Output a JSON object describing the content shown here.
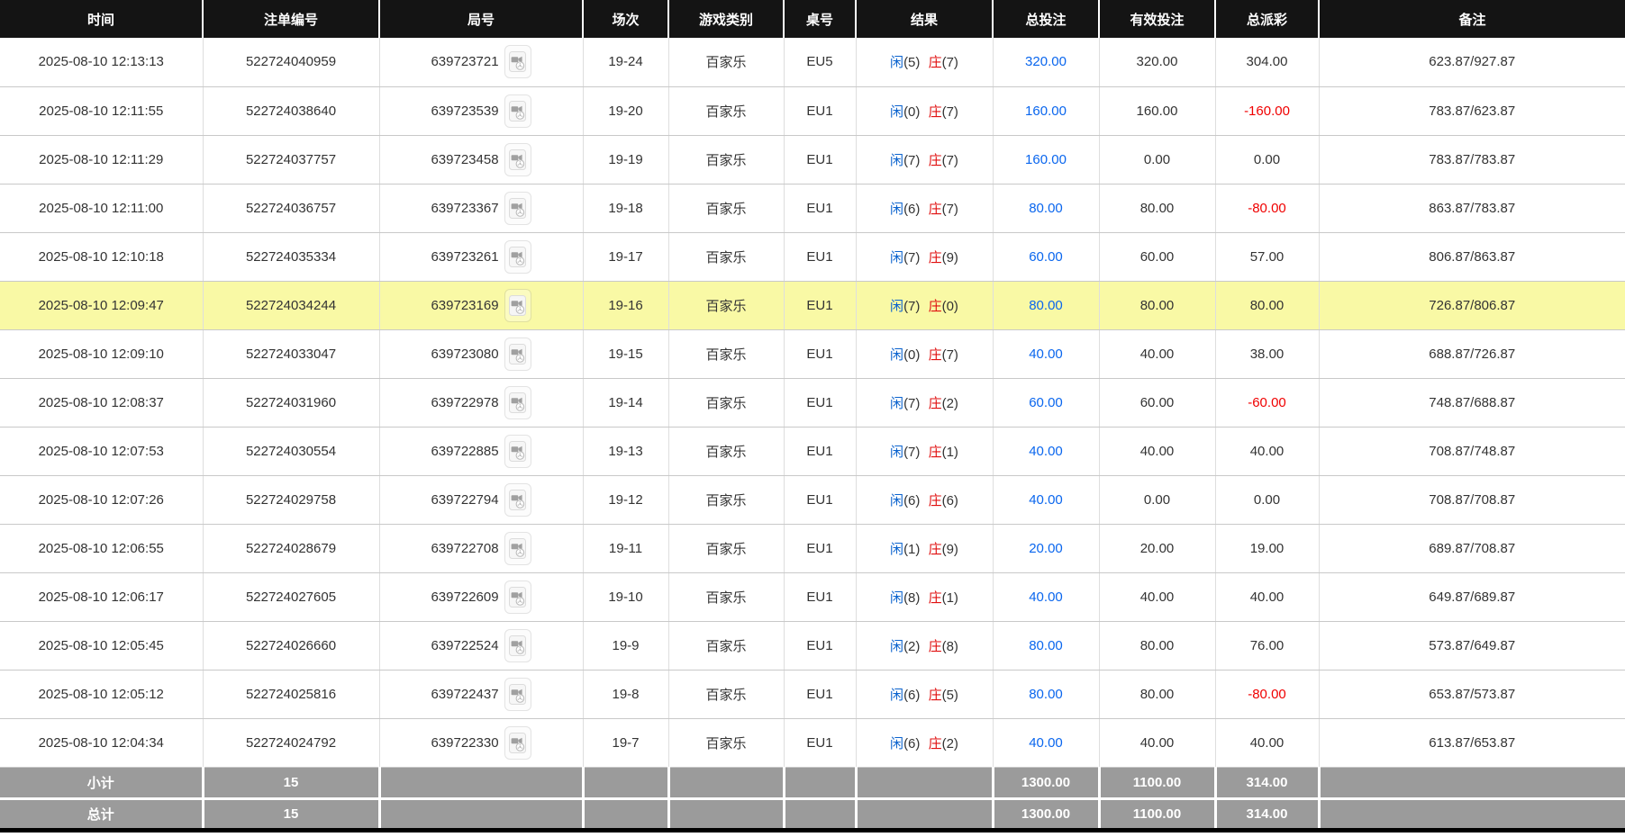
{
  "table": {
    "columns": [
      {
        "key": "time",
        "label": "时间"
      },
      {
        "key": "bet_id",
        "label": "注单编号"
      },
      {
        "key": "round_id",
        "label": "局号"
      },
      {
        "key": "session",
        "label": "场次"
      },
      {
        "key": "game_type",
        "label": "游戏类别"
      },
      {
        "key": "table_no",
        "label": "桌号"
      },
      {
        "key": "result",
        "label": "结果"
      },
      {
        "key": "total_bet",
        "label": "总投注"
      },
      {
        "key": "valid_bet",
        "label": "有效投注"
      },
      {
        "key": "total_payout",
        "label": "总派彩"
      },
      {
        "key": "remark",
        "label": "备注"
      }
    ],
    "result_labels": {
      "player": "闲",
      "banker": "庄"
    },
    "icons": {
      "round_video": "video-film-icon"
    },
    "rows": [
      {
        "time": "2025-08-10 12:13:13",
        "bet_id": "522724040959",
        "round_id": "639723721",
        "session": "19-24",
        "game_type": "百家乐",
        "table_no": "EU5",
        "player_pts": "(5)",
        "banker_pts": "(7)",
        "total_bet": "320.00",
        "valid_bet": "320.00",
        "total_payout": "304.00",
        "remark": "623.87/927.87",
        "highlighted": false
      },
      {
        "time": "2025-08-10 12:11:55",
        "bet_id": "522724038640",
        "round_id": "639723539",
        "session": "19-20",
        "game_type": "百家乐",
        "table_no": "EU1",
        "player_pts": "(0)",
        "banker_pts": "(7)",
        "total_bet": "160.00",
        "valid_bet": "160.00",
        "total_payout": "-160.00",
        "remark": "783.87/623.87",
        "highlighted": false
      },
      {
        "time": "2025-08-10 12:11:29",
        "bet_id": "522724037757",
        "round_id": "639723458",
        "session": "19-19",
        "game_type": "百家乐",
        "table_no": "EU1",
        "player_pts": "(7)",
        "banker_pts": "(7)",
        "total_bet": "160.00",
        "valid_bet": "0.00",
        "total_payout": "0.00",
        "remark": "783.87/783.87",
        "highlighted": false
      },
      {
        "time": "2025-08-10 12:11:00",
        "bet_id": "522724036757",
        "round_id": "639723367",
        "session": "19-18",
        "game_type": "百家乐",
        "table_no": "EU1",
        "player_pts": "(6)",
        "banker_pts": "(7)",
        "total_bet": "80.00",
        "valid_bet": "80.00",
        "total_payout": "-80.00",
        "remark": "863.87/783.87",
        "highlighted": false
      },
      {
        "time": "2025-08-10 12:10:18",
        "bet_id": "522724035334",
        "round_id": "639723261",
        "session": "19-17",
        "game_type": "百家乐",
        "table_no": "EU1",
        "player_pts": "(7)",
        "banker_pts": "(9)",
        "total_bet": "60.00",
        "valid_bet": "60.00",
        "total_payout": "57.00",
        "remark": "806.87/863.87",
        "highlighted": false
      },
      {
        "time": "2025-08-10 12:09:47",
        "bet_id": "522724034244",
        "round_id": "639723169",
        "session": "19-16",
        "game_type": "百家乐",
        "table_no": "EU1",
        "player_pts": "(7)",
        "banker_pts": "(0)",
        "total_bet": "80.00",
        "valid_bet": "80.00",
        "total_payout": "80.00",
        "remark": "726.87/806.87",
        "highlighted": true
      },
      {
        "time": "2025-08-10 12:09:10",
        "bet_id": "522724033047",
        "round_id": "639723080",
        "session": "19-15",
        "game_type": "百家乐",
        "table_no": "EU1",
        "player_pts": "(0)",
        "banker_pts": "(7)",
        "total_bet": "40.00",
        "valid_bet": "40.00",
        "total_payout": "38.00",
        "remark": "688.87/726.87",
        "highlighted": false
      },
      {
        "time": "2025-08-10 12:08:37",
        "bet_id": "522724031960",
        "round_id": "639722978",
        "session": "19-14",
        "game_type": "百家乐",
        "table_no": "EU1",
        "player_pts": "(7)",
        "banker_pts": "(2)",
        "total_bet": "60.00",
        "valid_bet": "60.00",
        "total_payout": "-60.00",
        "remark": "748.87/688.87",
        "highlighted": false
      },
      {
        "time": "2025-08-10 12:07:53",
        "bet_id": "522724030554",
        "round_id": "639722885",
        "session": "19-13",
        "game_type": "百家乐",
        "table_no": "EU1",
        "player_pts": "(7)",
        "banker_pts": "(1)",
        "total_bet": "40.00",
        "valid_bet": "40.00",
        "total_payout": "40.00",
        "remark": "708.87/748.87",
        "highlighted": false
      },
      {
        "time": "2025-08-10 12:07:26",
        "bet_id": "522724029758",
        "round_id": "639722794",
        "session": "19-12",
        "game_type": "百家乐",
        "table_no": "EU1",
        "player_pts": "(6)",
        "banker_pts": "(6)",
        "total_bet": "40.00",
        "valid_bet": "0.00",
        "total_payout": "0.00",
        "remark": "708.87/708.87",
        "highlighted": false
      },
      {
        "time": "2025-08-10 12:06:55",
        "bet_id": "522724028679",
        "round_id": "639722708",
        "session": "19-11",
        "game_type": "百家乐",
        "table_no": "EU1",
        "player_pts": "(1)",
        "banker_pts": "(9)",
        "total_bet": "20.00",
        "valid_bet": "20.00",
        "total_payout": "19.00",
        "remark": "689.87/708.87",
        "highlighted": false
      },
      {
        "time": "2025-08-10 12:06:17",
        "bet_id": "522724027605",
        "round_id": "639722609",
        "session": "19-10",
        "game_type": "百家乐",
        "table_no": "EU1",
        "player_pts": "(8)",
        "banker_pts": "(1)",
        "total_bet": "40.00",
        "valid_bet": "40.00",
        "total_payout": "40.00",
        "remark": "649.87/689.87",
        "highlighted": false
      },
      {
        "time": "2025-08-10 12:05:45",
        "bet_id": "522724026660",
        "round_id": "639722524",
        "session": "19-9",
        "game_type": "百家乐",
        "table_no": "EU1",
        "player_pts": "(2)",
        "banker_pts": "(8)",
        "total_bet": "80.00",
        "valid_bet": "80.00",
        "total_payout": "76.00",
        "remark": "573.87/649.87",
        "highlighted": false
      },
      {
        "time": "2025-08-10 12:05:12",
        "bet_id": "522724025816",
        "round_id": "639722437",
        "session": "19-8",
        "game_type": "百家乐",
        "table_no": "EU1",
        "player_pts": "(6)",
        "banker_pts": "(5)",
        "total_bet": "80.00",
        "valid_bet": "80.00",
        "total_payout": "-80.00",
        "remark": "653.87/573.87",
        "highlighted": false
      },
      {
        "time": "2025-08-10 12:04:34",
        "bet_id": "522724024792",
        "round_id": "639722330",
        "session": "19-7",
        "game_type": "百家乐",
        "table_no": "EU1",
        "player_pts": "(6)",
        "banker_pts": "(2)",
        "total_bet": "40.00",
        "valid_bet": "40.00",
        "total_payout": "40.00",
        "remark": "613.87/653.87",
        "highlighted": false
      }
    ],
    "subtotal": {
      "label": "小计",
      "count": "15",
      "total_bet": "1300.00",
      "valid_bet": "1100.00",
      "total_payout": "314.00"
    },
    "grand_total": {
      "label": "总计",
      "count": "15",
      "total_bet": "1300.00",
      "valid_bet": "1100.00",
      "total_payout": "314.00"
    },
    "colors": {
      "header_bg": "#141414",
      "highlight_row": "#F9F9A5",
      "player_blue": "#0B63CE",
      "banker_red": "#E01010",
      "bet_amount_blue": "#0A66EE",
      "negative_red": "#F00000",
      "summary_bg": "#9B9B9B"
    }
  }
}
